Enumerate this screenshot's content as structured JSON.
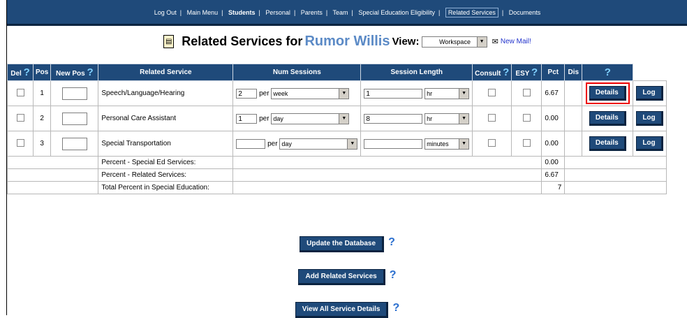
{
  "nav": {
    "items": [
      "Log Out",
      "Main Menu",
      "Students",
      "Personal",
      "Parents",
      "Team",
      "Special Education Eligibility",
      "Related Services",
      "Documents"
    ]
  },
  "heading": {
    "title": "Related Services for",
    "student_name": "Rumor Willis",
    "view_label": "View:",
    "view_value": "Workspace",
    "new_mail": "New Mail!"
  },
  "table": {
    "headers": {
      "del": "Del",
      "pos": "Pos",
      "new_pos": "New Pos",
      "service": "Related Service",
      "num_sessions": "Num Sessions",
      "session_length": "Session Length",
      "consult": "Consult",
      "esy": "ESY",
      "pct": "Pct",
      "dis": "Dis",
      "help": "?"
    },
    "rows": [
      {
        "pos": "1",
        "service": "Speech/Language/Hearing",
        "sessions": "2",
        "per": "per",
        "period": "week",
        "length": "1",
        "unit": "hr",
        "pct": "6.67",
        "details": "Details",
        "log": "Log"
      },
      {
        "pos": "2",
        "service": "Personal Care Assistant",
        "sessions": "1",
        "per": "per",
        "period": "day",
        "length": "8",
        "unit": "hr",
        "pct": "0.00",
        "details": "Details",
        "log": "Log"
      },
      {
        "pos": "3",
        "service": "Special Transportation",
        "sessions": "",
        "per": "per",
        "period": "day",
        "length": "",
        "unit": "minutes",
        "pct": "0.00",
        "details": "Details",
        "log": "Log"
      }
    ],
    "summary": [
      {
        "label": "Percent - Special Ed Services:",
        "value": "0.00"
      },
      {
        "label": "Percent - Related Services:",
        "value": "6.67"
      },
      {
        "label": "Total Percent in Special Education:",
        "value": "7"
      }
    ]
  },
  "actions": {
    "update": "Update the Database",
    "add": "Add Related Services",
    "view_all": "View All Service Details",
    "help": "?"
  }
}
